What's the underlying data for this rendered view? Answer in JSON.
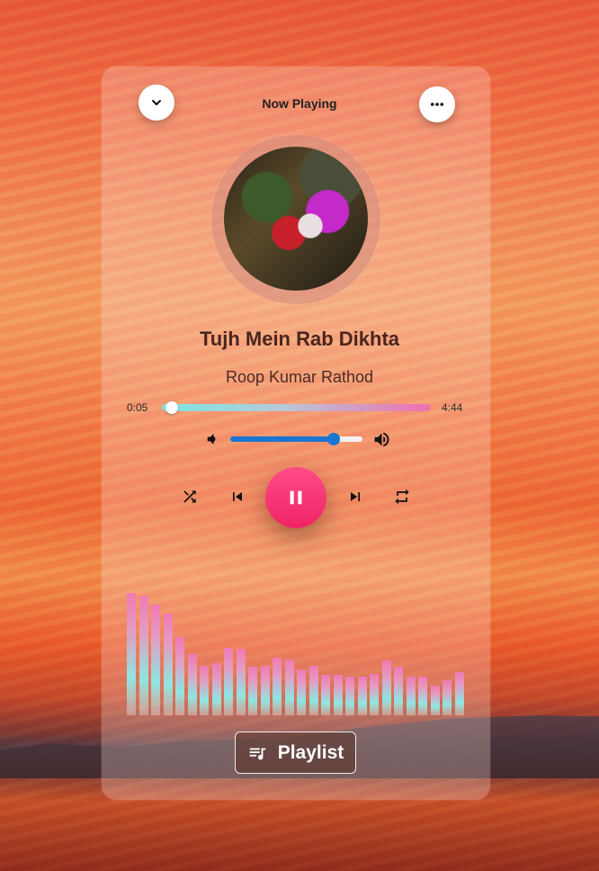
{
  "header": {
    "title": "Now Playing",
    "collapse_icon": "chevron-down-icon",
    "more_icon": "more-horizontal-icon"
  },
  "track": {
    "title": "Tujh Mein Rab Dikhta",
    "artist": "Roop Kumar Rathod"
  },
  "progress": {
    "current": "0:05",
    "total": "4:44",
    "fraction": 0.018
  },
  "volume": {
    "level": 0.78,
    "mute_icon": "volume-low-icon",
    "max_icon": "volume-high-icon"
  },
  "controls": {
    "shuffle_icon": "shuffle-icon",
    "previous_icon": "skip-previous-icon",
    "play_pause_icon": "pause-icon",
    "next_icon": "skip-next-icon",
    "repeat_icon": "repeat-icon"
  },
  "visualizer": {
    "levels": [
      0.94,
      0.92,
      0.85,
      0.78,
      0.6,
      0.47,
      0.38,
      0.4,
      0.52,
      0.51,
      0.37,
      0.38,
      0.44,
      0.43,
      0.35,
      0.38,
      0.31,
      0.31,
      0.3,
      0.3,
      0.32,
      0.42,
      0.37,
      0.3,
      0.3,
      0.23,
      0.27,
      0.33
    ]
  },
  "playlist": {
    "label": "Playlist",
    "icon": "queue-music-icon"
  },
  "colors": {
    "accent": "#f02366",
    "volume": "#1976d2"
  }
}
